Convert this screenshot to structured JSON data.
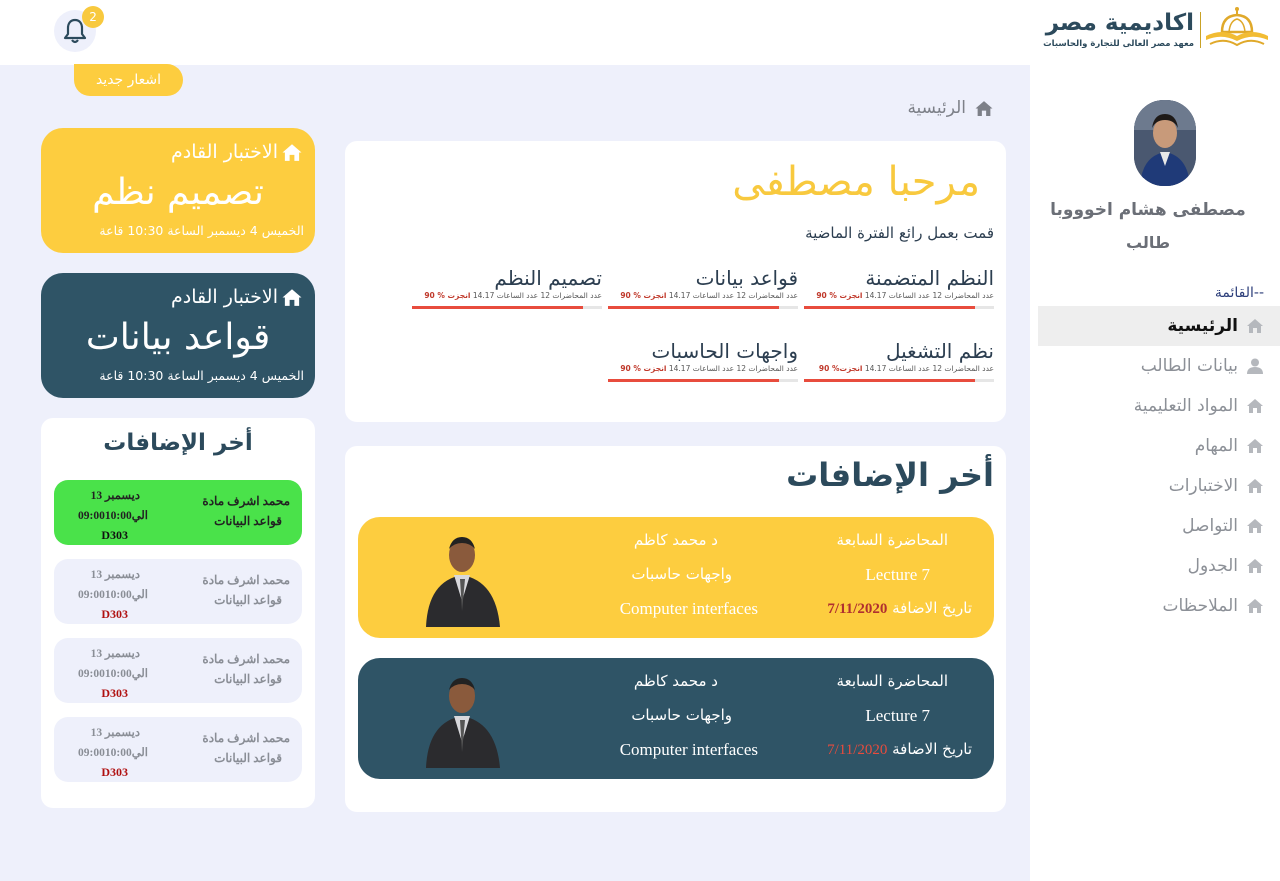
{
  "brand": {
    "name": "اكاديمية مصر",
    "tagline": "معهد مصر العالى للتجارة والحاسبات",
    "gold": "#f8c93e",
    "navy": "#2f5466"
  },
  "notifications": {
    "count": "2",
    "bubble": "اشعار جديد"
  },
  "user": {
    "name": "مصطفى هشام اخوووبا",
    "role": "طالب"
  },
  "sidebar": {
    "menu_label": "--القائمة",
    "items": [
      {
        "label": "الرئيسية",
        "icon": "home-icon",
        "active": true
      },
      {
        "label": "بيانات الطالب",
        "icon": "user-icon"
      },
      {
        "label": "المواد التعليمية",
        "icon": "home-icon"
      },
      {
        "label": "المهام",
        "icon": "home-icon"
      },
      {
        "label": "الاختبارات",
        "icon": "home-icon"
      },
      {
        "label": "التواصل",
        "icon": "home-icon"
      },
      {
        "label": "الجدول",
        "icon": "home-icon"
      },
      {
        "label": "الملاحظات",
        "icon": "home-icon"
      }
    ]
  },
  "breadcrumb": "الرئيسية",
  "welcome": {
    "title": "مرحبا مصطفى",
    "subtitle": "قمت بعمل رائع الفترة الماضية",
    "courses": [
      {
        "name": "النظم المتضمنة",
        "meta": "عدد المحاضرات 12 عدد الساعات 14.17",
        "done": "انجزت % 90",
        "progress": 0.9
      },
      {
        "name": "قواعد بيانات",
        "meta": "عدد المحاضرات 12 عدد الساعات 14.17",
        "done": "انجزت % 90",
        "progress": 0.9
      },
      {
        "name": "تصميم النظم",
        "meta": "عدد المحاضرات 12 عدد الساعات 14.17",
        "done": "انجزت % 90",
        "progress": 0.9
      },
      {
        "name": "نظم التشغيل",
        "meta": "عدد المحاضرات 12 عدد الساعات 14.17",
        "done": "انجزت% 90",
        "progress": 0.9
      },
      {
        "name": "واجهات الحاسبات",
        "meta": "عدد المحاضرات 12 عدد الساعات 14.17",
        "done": "انجزت % 90",
        "progress": 0.9
      }
    ]
  },
  "additions": {
    "title": "أخر الإضافات",
    "lectures": [
      {
        "title": "المحاضرة السابعة",
        "number": "Lecture 7",
        "date_label": "تاريخ الاضافة",
        "date": "7/11/2020",
        "doctor": "د محمد كاظم",
        "subject": "واجهات حاسبات",
        "subject_en": "Computer interfaces"
      },
      {
        "title": "المحاضرة السابعة",
        "number": "Lecture 7",
        "date_label": "تاريخ الاضافة",
        "date": "7/11/2020",
        "doctor": "د محمد كاظم",
        "subject": "واجهات حاسبات",
        "subject_en": "Computer interfaces"
      }
    ]
  },
  "exams": [
    {
      "label": "الاختبار القادم",
      "name": "تصميم نظم",
      "when": "الخميس 4 ديسمبر الساعة 10:30 قاعة"
    },
    {
      "label": "الاختبار القادم",
      "name": "قواعد بيانات",
      "when": "الخميس 4 ديسمبر الساعة 10:30 قاعة"
    }
  ],
  "recent": {
    "title": "أخر الإضافات",
    "items": [
      {
        "line1": "محمد اشرف مادة",
        "line2": "قواعد البيانات",
        "date1": "ديسمبر 13",
        "date2": "الي09:0010:00",
        "room": "D303"
      },
      {
        "line1": "محمد اشرف مادة",
        "line2": "قواعد البيانات",
        "date1": "ديسمبر 13",
        "date2": "الي09:0010:00",
        "room": "D303"
      },
      {
        "line1": "محمد اشرف مادة",
        "line2": "قواعد البيانات",
        "date1": "ديسمبر 13",
        "date2": "الي09:0010:00",
        "room": "D303"
      },
      {
        "line1": "محمد اشرف مادة",
        "line2": "قواعد البيانات",
        "date1": "ديسمبر 13",
        "date2": "الي09:0010:00",
        "room": "D303"
      }
    ]
  }
}
